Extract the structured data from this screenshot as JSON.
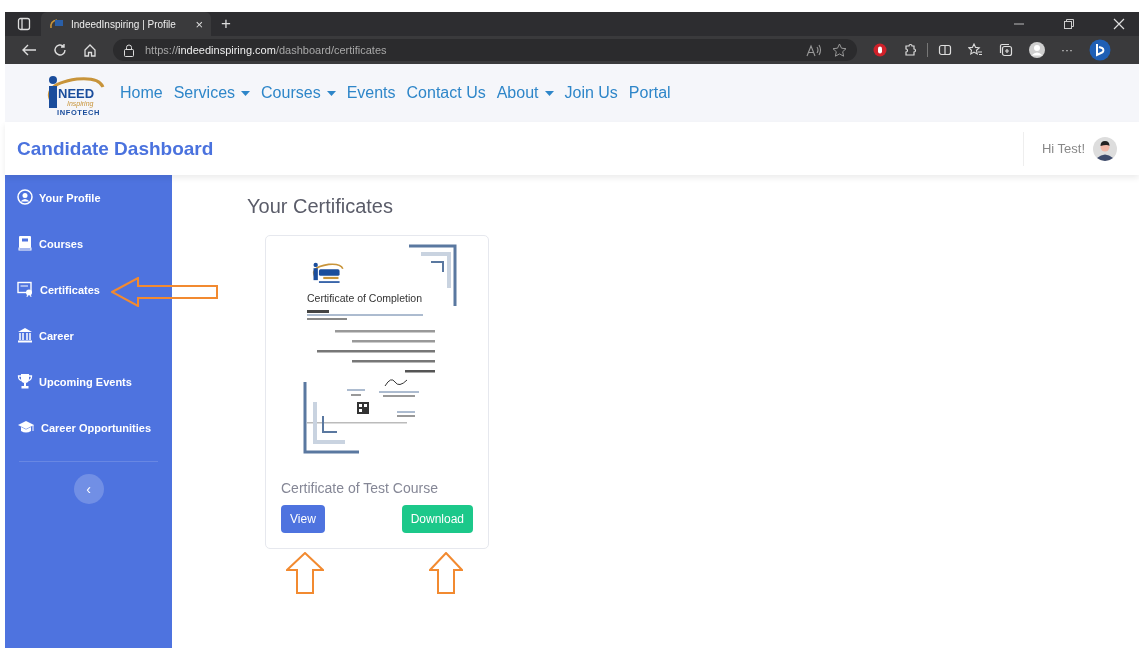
{
  "browser": {
    "tab_title": "IndeedInspiring | Profile",
    "tab_close": "×",
    "new_tab": "+",
    "url": {
      "scheme": "https://",
      "host": "indeedinspiring.com",
      "path": "/dashboard/certificates"
    },
    "more": "···"
  },
  "logo": {
    "mark": "NEED",
    "sub": "Inspiring",
    "tag": "INFOTECH"
  },
  "nav": [
    {
      "label": "Home",
      "dropdown": false
    },
    {
      "label": "Services",
      "dropdown": true
    },
    {
      "label": "Courses",
      "dropdown": true
    },
    {
      "label": "Events",
      "dropdown": false
    },
    {
      "label": "Contact Us",
      "dropdown": false
    },
    {
      "label": "About",
      "dropdown": true
    },
    {
      "label": "Join Us",
      "dropdown": false
    },
    {
      "label": "Portal",
      "dropdown": false
    }
  ],
  "header": {
    "title": "Candidate Dashboard",
    "greeting": "Hi Test!"
  },
  "sidebar": {
    "items": [
      {
        "label": "Your Profile",
        "kind": "profile"
      },
      {
        "label": "Courses",
        "kind": "book"
      },
      {
        "label": "Certificates",
        "kind": "certificate"
      },
      {
        "label": "Career",
        "kind": "bank"
      },
      {
        "label": "Upcoming Events",
        "kind": "trophy"
      },
      {
        "label": "Career Opportunities",
        "kind": "cap"
      }
    ],
    "collapse": "‹"
  },
  "page_title": "Your Certificates",
  "certificates": [
    {
      "preview": {
        "heading": "Certificate  of Completion"
      },
      "title": "Certificate of Test Course",
      "buttons": [
        {
          "label": "View",
          "kind": "primary"
        },
        {
          "label": "Download",
          "kind": "success"
        }
      ]
    }
  ]
}
